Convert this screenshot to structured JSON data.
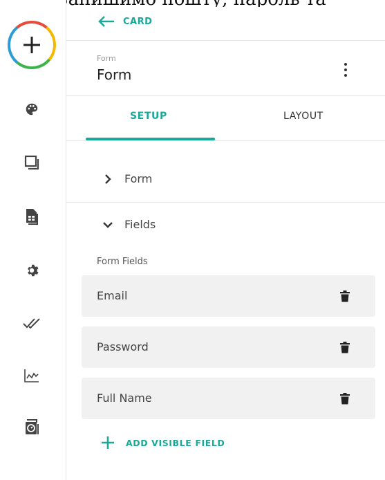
{
  "top_cut_text": "поля. Запишимо пошту, пароль та",
  "header": {
    "back_label": "CARD",
    "section_small": "Form",
    "title": "Form"
  },
  "tabs": [
    {
      "label": "SETUP",
      "active": true
    },
    {
      "label": "LAYOUT",
      "active": false
    }
  ],
  "sections": {
    "form_label": "Form",
    "fields_label": "Fields",
    "form_fields_label": "Form Fields"
  },
  "fields": [
    {
      "name": "Email"
    },
    {
      "name": "Password"
    },
    {
      "name": "Full Name"
    }
  ],
  "add_visible_field_label": "ADD VISIBLE FIELD",
  "colors": {
    "accent": "#1aa898",
    "field_bg": "#f1f1f1"
  },
  "rail_icons": [
    "palette-icon",
    "layers-icon",
    "sheet-icon",
    "gear-icon",
    "double-check-icon",
    "analytics-icon",
    "stopwatch-icon"
  ]
}
